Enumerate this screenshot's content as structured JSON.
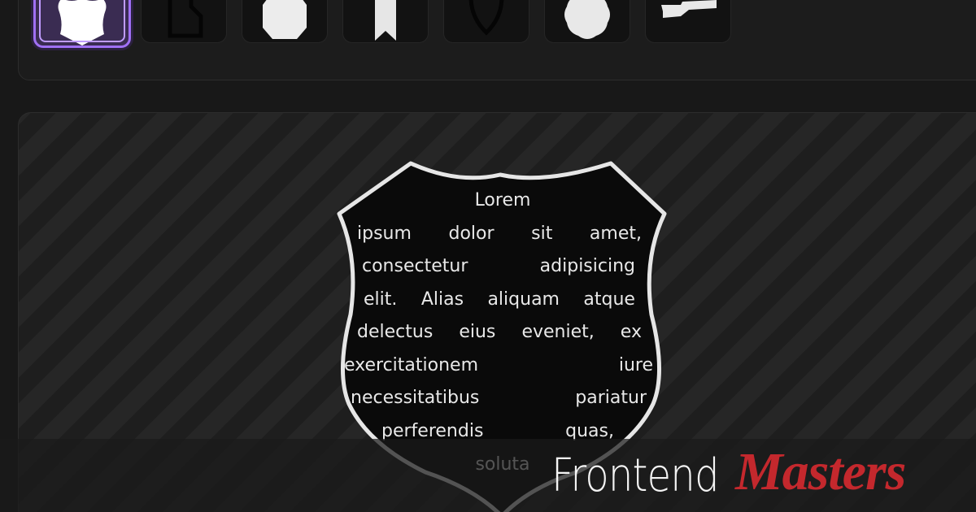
{
  "shape_picker": {
    "shapes": [
      {
        "name": "shield",
        "icon": "shield-icon",
        "selected": true
      },
      {
        "name": "folded-corner",
        "icon": "folded-corner-icon",
        "selected": false
      },
      {
        "name": "octagon",
        "icon": "octagon-icon",
        "selected": false
      },
      {
        "name": "ribbon-bookmark",
        "icon": "bookmark-icon",
        "selected": false
      },
      {
        "name": "heart",
        "icon": "heart-icon",
        "selected": false
      },
      {
        "name": "badge-seal",
        "icon": "seal-icon",
        "selected": false
      },
      {
        "name": "state-outline",
        "icon": "state-outline-icon",
        "selected": false
      }
    ]
  },
  "preview": {
    "lines": [
      [
        "Lorem"
      ],
      [
        "ipsum",
        "dolor",
        "sit",
        "amet,"
      ],
      [
        "consectetur",
        "adipisicing"
      ],
      [
        "elit.",
        "Alias",
        "aliquam",
        "atque"
      ],
      [
        "delectus",
        "eius",
        "eveniet,",
        "ex"
      ],
      [
        "exercitationem",
        "iure"
      ],
      [
        "necessitatibus",
        "pariatur"
      ],
      [
        "perferendis",
        "quas,"
      ],
      [
        "soluta"
      ]
    ]
  },
  "brand": {
    "part1": "Frontend",
    "part2": "Masters"
  },
  "colors": {
    "selected_accent": "#a070f5",
    "brand_red": "#c4282d",
    "shield_fill": "#0a0a0a",
    "shield_stroke": "#e6e6e6"
  }
}
